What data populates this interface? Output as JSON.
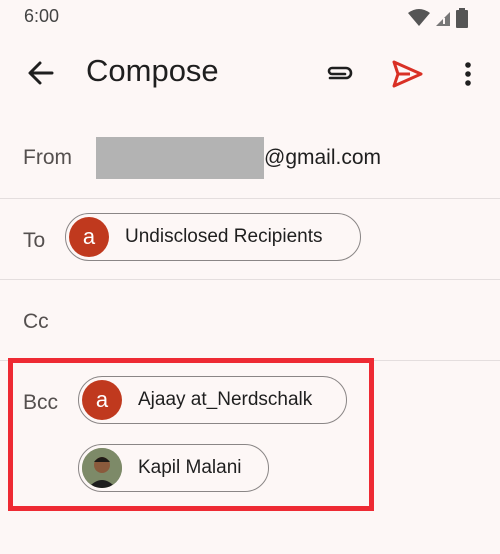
{
  "status_bar": {
    "time": "6:00"
  },
  "app_bar": {
    "title": "Compose"
  },
  "from": {
    "label": "From",
    "email_suffix": "@gmail.com"
  },
  "to": {
    "label": "To",
    "recipients": [
      {
        "initial": "a",
        "name": "Undisclosed Recipients"
      }
    ]
  },
  "cc": {
    "label": "Cc"
  },
  "bcc": {
    "label": "Bcc",
    "recipients": [
      {
        "initial": "a",
        "name": "Ajaay at_Nerdschalk"
      },
      {
        "initial": "",
        "name": "Kapil Malani"
      }
    ]
  },
  "colors": {
    "accent_red": "#c0391e",
    "send_red": "#d93025",
    "highlight": "#ee2a33"
  }
}
